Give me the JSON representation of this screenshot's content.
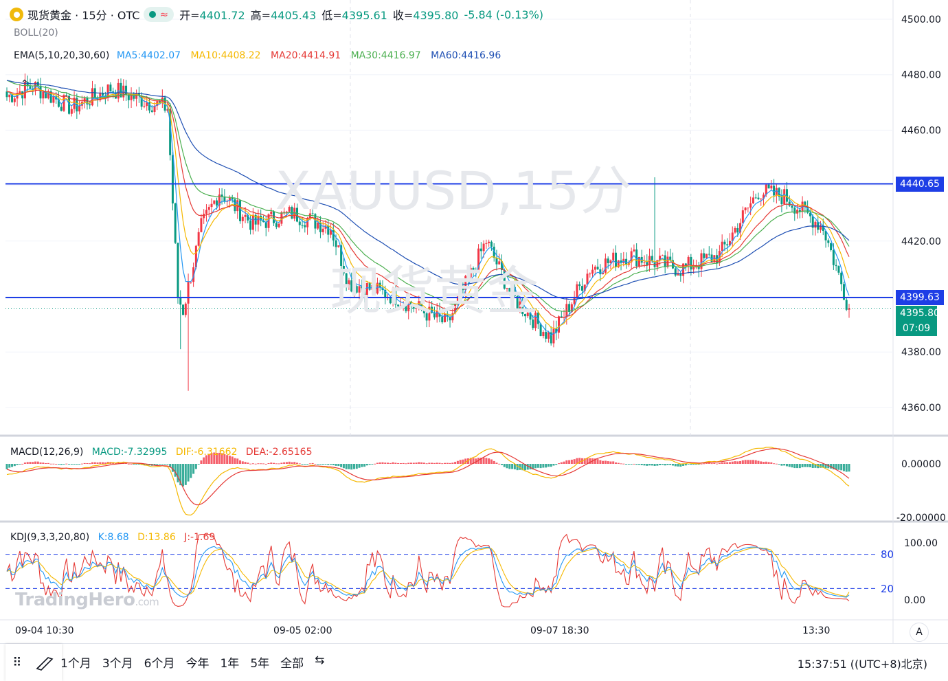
{
  "header": {
    "symbol": "现货黄金 · 15分 · OTC",
    "open_label": "开",
    "open": "4401.72",
    "high_label": "高",
    "high": "4405.43",
    "low_label": "低",
    "low": "4395.61",
    "close_label": "收",
    "close": "4395.80",
    "change": "-5.84 (-0.13%)"
  },
  "indicators": {
    "boll": "BOLL(20)",
    "ema": {
      "name": "EMA(5,10,20,30,60)",
      "ma5": "MA5:4402.07",
      "ma10": "MA10:4408.22",
      "ma20": "MA20:4414.91",
      "ma30": "MA30:4416.97",
      "ma60": "MA60:4416.96"
    },
    "macd": {
      "name": "MACD(12,26,9)",
      "macd": "MACD:-7.32995",
      "dif": "DIF:-6.31662",
      "dea": "DEA:-2.65165"
    },
    "kdj": {
      "name": "KDJ(9,3,3,20,80)",
      "k": "K:8.68",
      "d": "D:13.86",
      "j": "J:-1.69"
    }
  },
  "watermark": {
    "line1": "XAUUSD,15分",
    "line2": "现货黄金"
  },
  "logo": {
    "main": "TradingHero",
    "suffix": ".com"
  },
  "price_labels": {
    "line_upper": "4440.65",
    "line_lower": "4399.63",
    "last": "4395.80",
    "countdown": "07:09"
  },
  "kdj_levels": {
    "upper": "80",
    "lower": "20"
  },
  "time_labels": [
    "09-04 10:30",
    "09-05 02:00",
    "09-07 18:30",
    "13:30"
  ],
  "toolbar": {
    "ranges": [
      "1个月",
      "3个月",
      "6个月",
      "今年",
      "1年",
      "5年",
      "全部"
    ],
    "clock": "15:37:51 ((UTC+8)北京)",
    "auto": "A"
  },
  "colors": {
    "up": "#f23645",
    "down": "#089981",
    "ma5": "#2196f3",
    "ma10": "#f5b800",
    "ma20": "#e53935",
    "ma30": "#4caf50",
    "ma60": "#1e4fb3",
    "hline": "#1e3ee6"
  },
  "chart_data": [
    {
      "type": "candlestick",
      "title": "XAUUSD 15分",
      "y_ticks": [
        4500,
        4480,
        4460,
        4440,
        4420,
        4400,
        4380,
        4360
      ],
      "ylim": [
        4351,
        4506
      ],
      "horizontal_lines": [
        4440.65,
        4399.63
      ],
      "last_price": 4395.8,
      "key_points": [
        {
          "t": 0,
          "close": 4472
        },
        {
          "t": 10,
          "close": 4476
        },
        {
          "t": 25,
          "close": 4468
        },
        {
          "t": 40,
          "close": 4475
        },
        {
          "t": 55,
          "close": 4470
        },
        {
          "t": 62,
          "close": 4468
        },
        {
          "t": 66,
          "close": 4400
        },
        {
          "t": 68,
          "close": 4395
        },
        {
          "t": 75,
          "close": 4425
        },
        {
          "t": 82,
          "close": 4438
        },
        {
          "t": 95,
          "close": 4426
        },
        {
          "t": 110,
          "close": 4430
        },
        {
          "t": 125,
          "close": 4425
        },
        {
          "t": 132,
          "close": 4405
        },
        {
          "t": 150,
          "close": 4400
        },
        {
          "t": 170,
          "close": 4390
        },
        {
          "t": 185,
          "close": 4420
        },
        {
          "t": 195,
          "close": 4400
        },
        {
          "t": 210,
          "close": 4385
        },
        {
          "t": 225,
          "close": 4410
        },
        {
          "t": 240,
          "close": 4415
        },
        {
          "t": 260,
          "close": 4410
        },
        {
          "t": 275,
          "close": 4415
        },
        {
          "t": 290,
          "close": 4438
        },
        {
          "t": 300,
          "close": 4436
        },
        {
          "t": 315,
          "close": 4425
        },
        {
          "t": 325,
          "close": 4395.8
        }
      ],
      "ma_last": {
        "MA5": 4402.07,
        "MA10": 4408.22,
        "MA20": 4414.91,
        "MA30": 4416.97,
        "MA60": 4416.96
      }
    },
    {
      "type": "bar",
      "title": "MACD(12,26,9)",
      "y_ticks": [
        0,
        -20
      ],
      "last": {
        "MACD": -7.32995,
        "DIF": -6.31662,
        "DEA": -2.65165
      }
    },
    {
      "type": "line",
      "title": "KDJ(9,3,3,20,80)",
      "y_ticks": [
        100,
        0
      ],
      "levels": [
        80,
        20
      ],
      "last": {
        "K": 8.68,
        "D": 13.86,
        "J": -1.69
      }
    }
  ]
}
